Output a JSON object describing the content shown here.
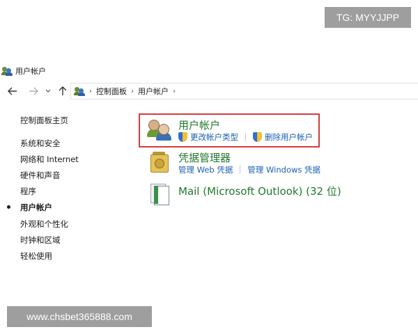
{
  "watermarks": {
    "top": "TG: MYYJJPP",
    "bottom": "www.chsbet365888.com"
  },
  "window": {
    "title": "用户帐户"
  },
  "nav": {
    "back_icon": "arrow-left-icon",
    "forward_icon": "arrow-right-icon",
    "recent_icon": "chevron-down-icon",
    "up_icon": "arrow-up-icon"
  },
  "address": {
    "crumbs": [
      "控制面板",
      "用户帐户"
    ]
  },
  "sidebar": {
    "items": [
      {
        "label": "控制面板主页",
        "active": false
      },
      {
        "label": "系统和安全",
        "active": false
      },
      {
        "label": "网络和 Internet",
        "active": false
      },
      {
        "label": "硬件和声音",
        "active": false
      },
      {
        "label": "程序",
        "active": false
      },
      {
        "label": "用户帐户",
        "active": true
      },
      {
        "label": "外观和个性化",
        "active": false
      },
      {
        "label": "时钟和区域",
        "active": false
      },
      {
        "label": "轻松使用",
        "active": false
      }
    ]
  },
  "main": {
    "sections": [
      {
        "title": "用户帐户",
        "icon": "users-icon",
        "links": [
          "更改帐户类型",
          "删除用户帐户"
        ]
      },
      {
        "title": "凭据管理器",
        "icon": "credential-vault-icon",
        "links": [
          "管理 Web 凭据",
          "管理 Windows 凭据"
        ]
      },
      {
        "title": "Mail (Microsoft Outlook) (32 位)",
        "icon": "mail-icon",
        "links": []
      }
    ]
  },
  "colors": {
    "section_title": "#1f7a2c",
    "link": "#1a5fb4",
    "highlight_border": "#d23c3c"
  }
}
